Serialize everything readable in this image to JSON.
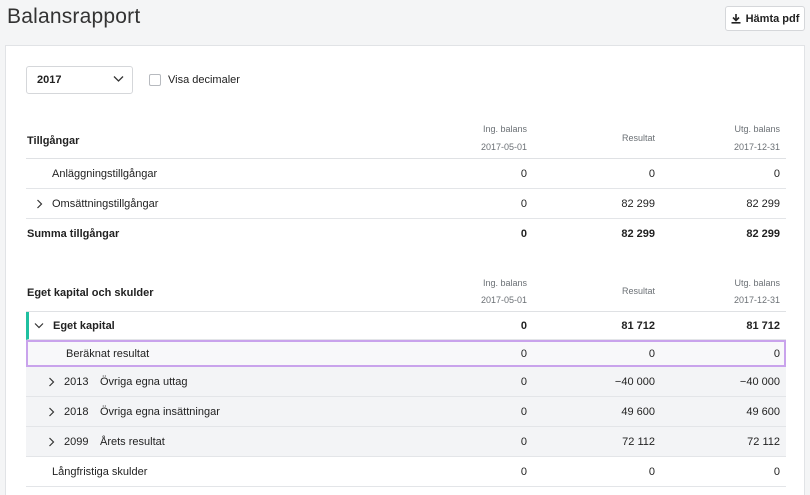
{
  "header": {
    "title": "Balansrapport",
    "pdf_label": "Hämta pdf"
  },
  "filters": {
    "year": "2017",
    "decimals_label": "Visa decimaler"
  },
  "columns": {
    "ing_label": "Ing. balans",
    "ing_date": "2017-05-01",
    "res_label": "Resultat",
    "utg_label": "Utg. balans",
    "utg_date": "2017-12-31"
  },
  "assets": {
    "title": "Tillgångar",
    "rows": [
      {
        "label": "Anläggningstillgångar",
        "ing": "0",
        "res": "0",
        "utg": "0"
      },
      {
        "label": "Omsättningstillgångar",
        "ing": "0",
        "res": "82 299",
        "utg": "82 299"
      }
    ],
    "total": {
      "label": "Summa tillgångar",
      "ing": "0",
      "res": "82 299",
      "utg": "82 299"
    }
  },
  "equity": {
    "title": "Eget kapital och skulder",
    "group": {
      "label": "Eget kapital",
      "ing": "0",
      "res": "81 712",
      "utg": "81 712"
    },
    "computed": {
      "label": "Beräknat resultat",
      "ing": "0",
      "res": "0",
      "utg": "0"
    },
    "accounts": [
      {
        "num": "2013",
        "label": "Övriga egna uttag",
        "ing": "0",
        "res": "−40 000",
        "utg": "−40 000"
      },
      {
        "num": "2018",
        "label": "Övriga egna insättningar",
        "ing": "0",
        "res": "49 600",
        "utg": "49 600"
      },
      {
        "num": "2099",
        "label": "Årets resultat",
        "ing": "0",
        "res": "72 112",
        "utg": "72 112"
      }
    ],
    "long_term": {
      "label": "Långfristiga skulder",
      "ing": "0",
      "res": "0",
      "utg": "0"
    }
  }
}
